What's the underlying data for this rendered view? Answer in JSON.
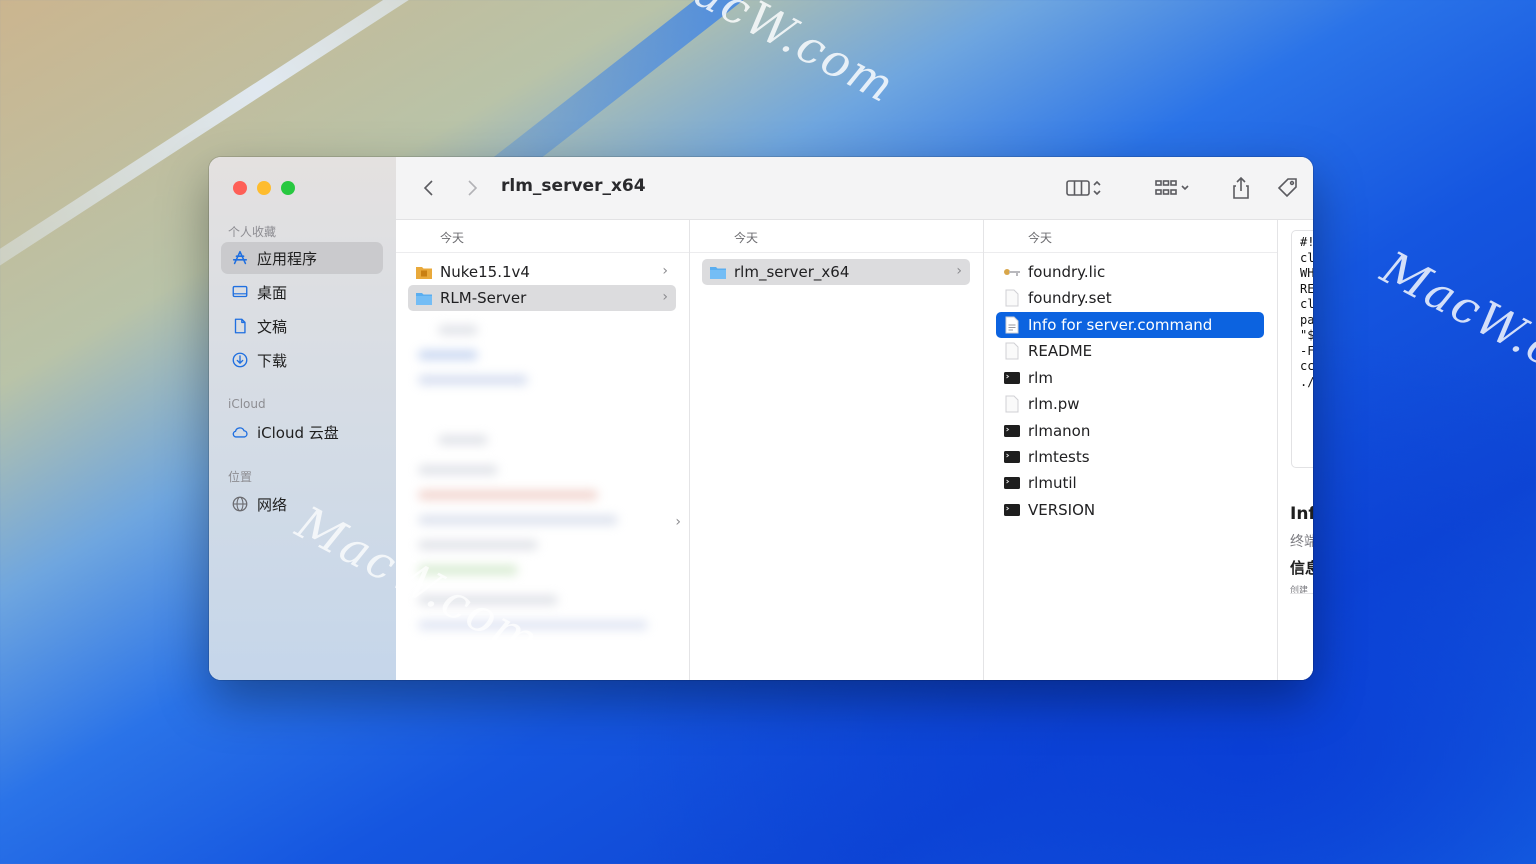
{
  "wallpaper": {
    "watermark": "MacW.com"
  },
  "window": {
    "title": "rlm_server_x64",
    "sidebar": {
      "sections": [
        {
          "label": "个人收藏",
          "items": [
            {
              "label": "应用程序",
              "icon": "app-store-icon",
              "active": true
            },
            {
              "label": "桌面",
              "icon": "desktop-icon"
            },
            {
              "label": "文稿",
              "icon": "document-icon"
            },
            {
              "label": "下载",
              "icon": "download-icon"
            }
          ]
        },
        {
          "label": "iCloud",
          "items": [
            {
              "label": "iCloud 云盘",
              "icon": "cloud-icon"
            }
          ]
        },
        {
          "label": "位置",
          "items": [
            {
              "label": "网络",
              "icon": "globe-icon"
            }
          ]
        }
      ]
    },
    "columns": [
      {
        "header": "今天",
        "items": [
          {
            "name": "Nuke15.1v4",
            "icon": "package-icon",
            "has_children": true
          },
          {
            "name": "RLM-Server",
            "icon": "folder-icon",
            "has_children": true,
            "selected": "gray"
          }
        ]
      },
      {
        "header": "今天",
        "items": [
          {
            "name": "rlm_server_x64",
            "icon": "folder-icon",
            "has_children": true,
            "selected": "gray"
          }
        ]
      },
      {
        "header": "今天",
        "items": [
          {
            "name": "foundry.lic",
            "icon": "key-icon"
          },
          {
            "name": "foundry.set",
            "icon": "file-icon"
          },
          {
            "name": "Info for server.command",
            "icon": "file-icon",
            "selected": "blue"
          },
          {
            "name": "README",
            "icon": "file-icon"
          },
          {
            "name": "rlm",
            "icon": "terminal-icon"
          },
          {
            "name": "rlm.pw",
            "icon": "file-icon"
          },
          {
            "name": "rlmanon",
            "icon": "terminal-icon"
          },
          {
            "name": "rlmtests",
            "icon": "terminal-icon"
          },
          {
            "name": "rlmutil",
            "icon": "terminal-icon"
          },
          {
            "name": "VERSION",
            "icon": "terminal-icon"
          }
        ]
      }
    ],
    "preview": {
      "code_lines": [
        "#!",
        "cl",
        "WH",
        "RE",
        "cl",
        "pa",
        "\"$",
        "-F",
        "cc",
        "./"
      ],
      "info_title": "Inf",
      "info_subtitle": "终端",
      "info_heading": "信息",
      "info_meta": "创建"
    },
    "colors": {
      "selection_blue": "#0c63e0",
      "close": "#fe5f57",
      "minimize": "#febc2e",
      "maximize": "#28c840"
    }
  }
}
